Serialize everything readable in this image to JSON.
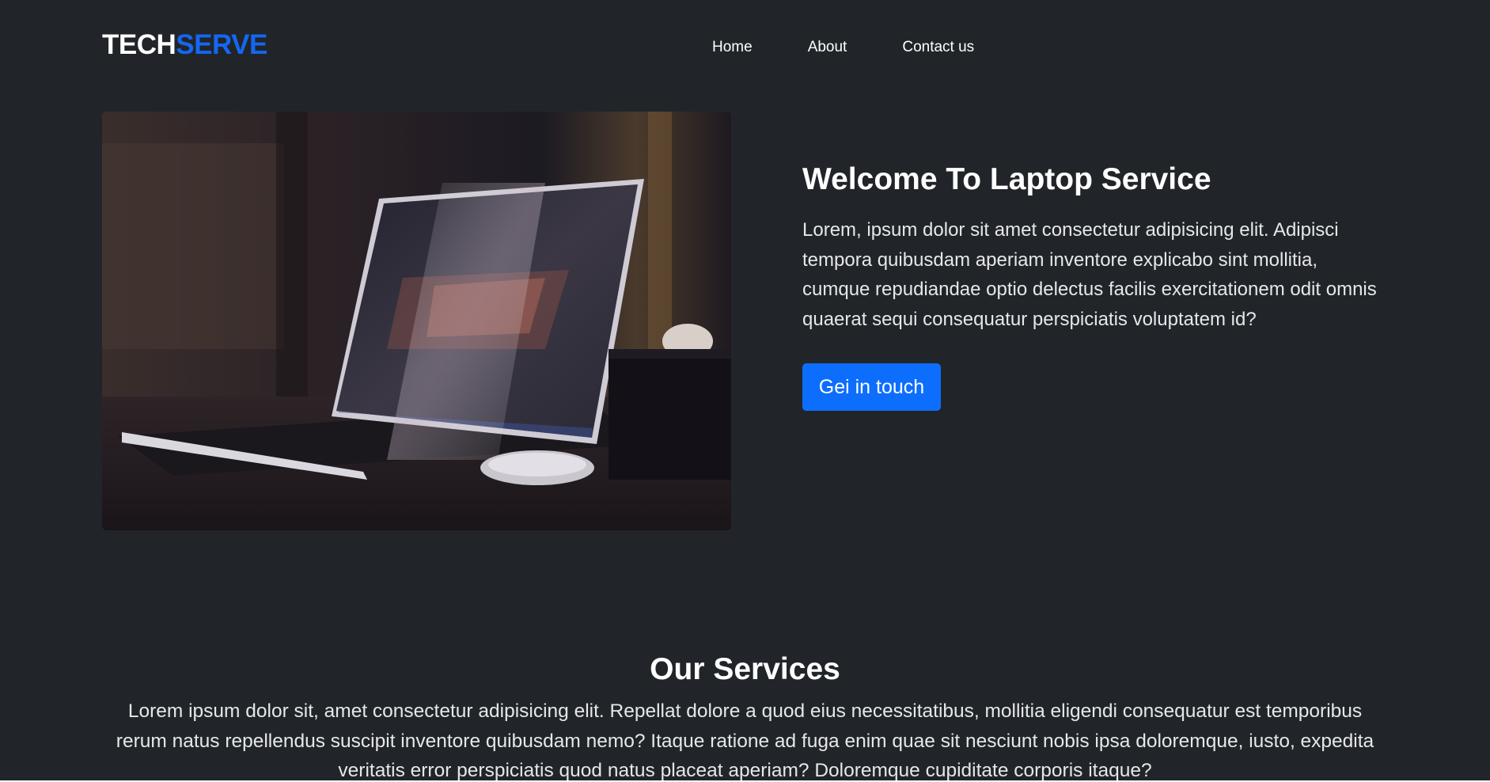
{
  "brand": {
    "main": "TECH",
    "accent": "SERVE"
  },
  "nav": {
    "items": [
      {
        "label": "Home"
      },
      {
        "label": "About"
      },
      {
        "label": "Contact us"
      }
    ]
  },
  "hero": {
    "title": "Welcome To Laptop Service",
    "paragraph": "Lorem, ipsum dolor sit amet consectetur adipisicing elit. Adipisci tempora quibusdam aperiam inventore explicabo sint mollitia, cumque repudiandae optio delectus facilis exercitationem odit omnis quaerat sequi consequatur perspiciatis voluptatem id?",
    "button_label": "Gei in touch"
  },
  "services": {
    "title": "Our Services",
    "paragraph": "Lorem ipsum dolor sit, amet consectetur adipisicing elit. Repellat dolore a quod eius necessitatibus, mollitia eligendi consequatur est temporibus rerum natus repellendus suscipit inventore quibusdam nemo? Itaque ratione ad fuga enim quae sit nesciunt nobis ipsa doloremque, iusto, expedita veritatis error perspiciatis quod natus placeat aperiam? Doloremque cupiditate corporis itaque?"
  },
  "colors": {
    "background": "#212529",
    "accent": "#1467f2",
    "button": "#0d6efd",
    "text": "#ffffff"
  }
}
